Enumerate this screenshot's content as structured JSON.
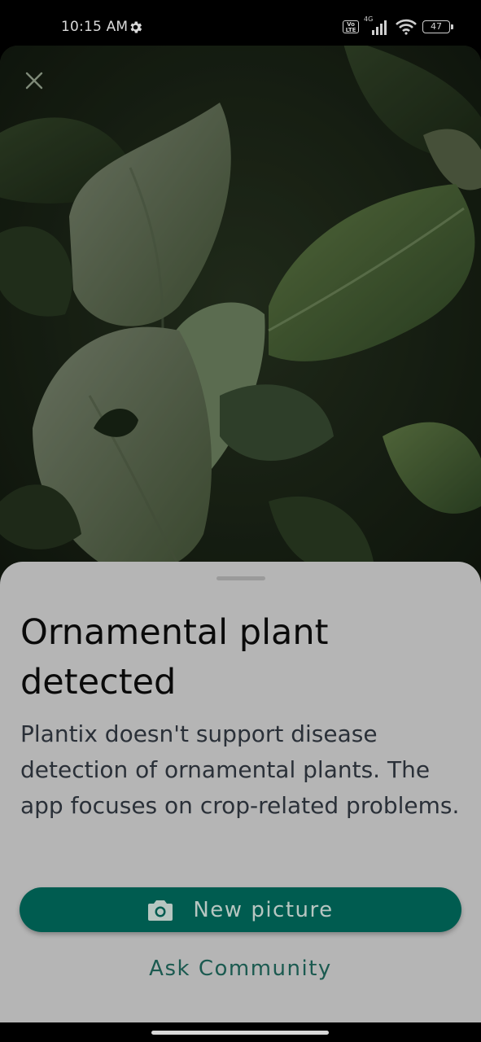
{
  "status_bar": {
    "time": "10:15 AM",
    "network": "4G",
    "volte": "Vo LTE",
    "battery": "47"
  },
  "photo": {
    "close_icon": "close-icon"
  },
  "sheet": {
    "title": "Ornamental plant detected",
    "description": "Plantix doesn't support disease detection of ornamental plants. The app focuses on crop-related problems.",
    "primary_button": {
      "label": "New picture",
      "icon": "camera-icon"
    },
    "secondary_button": {
      "label": "Ask Community"
    }
  },
  "colors": {
    "accent": "#005c50",
    "link": "#1b5a50",
    "sheet_bg": "#b5b5b5"
  }
}
